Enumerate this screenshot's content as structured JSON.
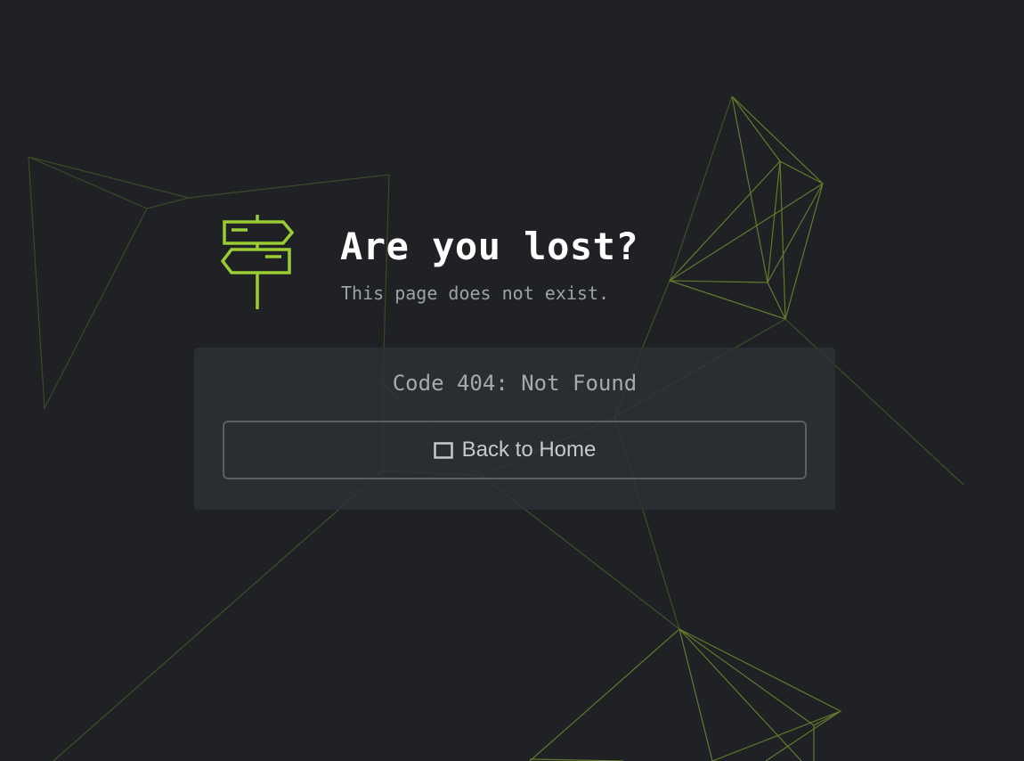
{
  "error": {
    "title": "Are you lost?",
    "subtitle": "This page does not exist.",
    "code_message": "Code 404: Not Found"
  },
  "actions": {
    "home_label": "Back to Home",
    "home_icon": "window-icon"
  },
  "icons": {
    "hero": "signpost-icon"
  },
  "colors": {
    "accent": "#9acd32",
    "background": "#1f2125",
    "panel": "#2e3135",
    "title": "#ffffff",
    "muted_text": "#9ea2a6",
    "button_border": "#5c6065"
  }
}
